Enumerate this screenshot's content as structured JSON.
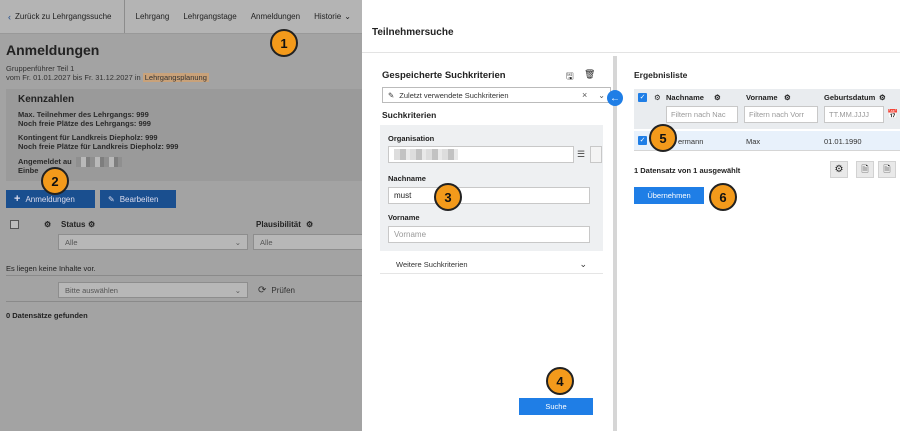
{
  "topnav": {
    "back_label": "Zurück zu Lehrgangssuche",
    "items": [
      "Lehrgang",
      "Lehrgangstage",
      "Anmeldungen",
      "Historie"
    ]
  },
  "page": {
    "title": "Anmeldungen",
    "subtitle_line1": "Gruppenführer Teil 1",
    "subtitle_line2_prefix": "vom Fr. 01.01.2027 bis Fr. 31.12.2027 in",
    "subtitle_line2_highlight": "Lehrgangsplanung"
  },
  "kennzahlen": {
    "title": "Kennzahlen",
    "lines": [
      "Max. Teilnehmer des Lehrgangs: 999",
      "Noch freie Plätze des Lehrgangs: 999",
      "Kontingent für Landkreis Diepholz: 999",
      "Noch freie Plätze für Landkreis Diepholz: 999",
      "Angemeldet au",
      "Einbe"
    ]
  },
  "buttons": {
    "anmeldungen": "Anmeldungen",
    "bearbeiten": "Bearbeiten",
    "pruefen": "Prüfen"
  },
  "table": {
    "columns": [
      "Status",
      "Plausibilität"
    ],
    "filter_status": "Alle",
    "filter_plaus": "Alle",
    "empty_text": "Es liegen keine Inhalte vor.",
    "bulk_placeholder": "Bitte auswählen",
    "count_text": "0 Datensätze gefunden"
  },
  "dialog": {
    "title": "Teilnehmersuche",
    "saved_criteria_title": "Gespeicherte Suchkriterien",
    "saved_criteria_value": "Zuletzt verwendete Suchkriterien",
    "criteria_title": "Suchkriterien",
    "org_label": "Organisation",
    "nachname_label": "Nachname",
    "nachname_value": "must",
    "vorname_label": "Vorname",
    "vorname_placeholder": "Vorname",
    "more_criteria": "Weitere Suchkriterien",
    "search_button": "Suche"
  },
  "results": {
    "title": "Ergebnisliste",
    "columns": [
      "Nachname",
      "Vorname",
      "Geburtsdatum"
    ],
    "filter_nachname": "Filtern nach Nac",
    "filter_vorname": "Filtern nach Vorr",
    "filter_date": "TT.MM.JJJJ",
    "row": {
      "nachname": "ermann",
      "vorname": "Max",
      "geburtsdatum": "01.01.1990"
    },
    "info": "1 Datensatz von 1 ausgewählt",
    "apply_button": "Übernehmen"
  },
  "callouts": [
    "1",
    "2",
    "3",
    "4",
    "5",
    "6"
  ],
  "colors": {
    "primary": "#1f7ee6",
    "callout": "#f39a1b",
    "dark_button": "#1a4f8f"
  }
}
